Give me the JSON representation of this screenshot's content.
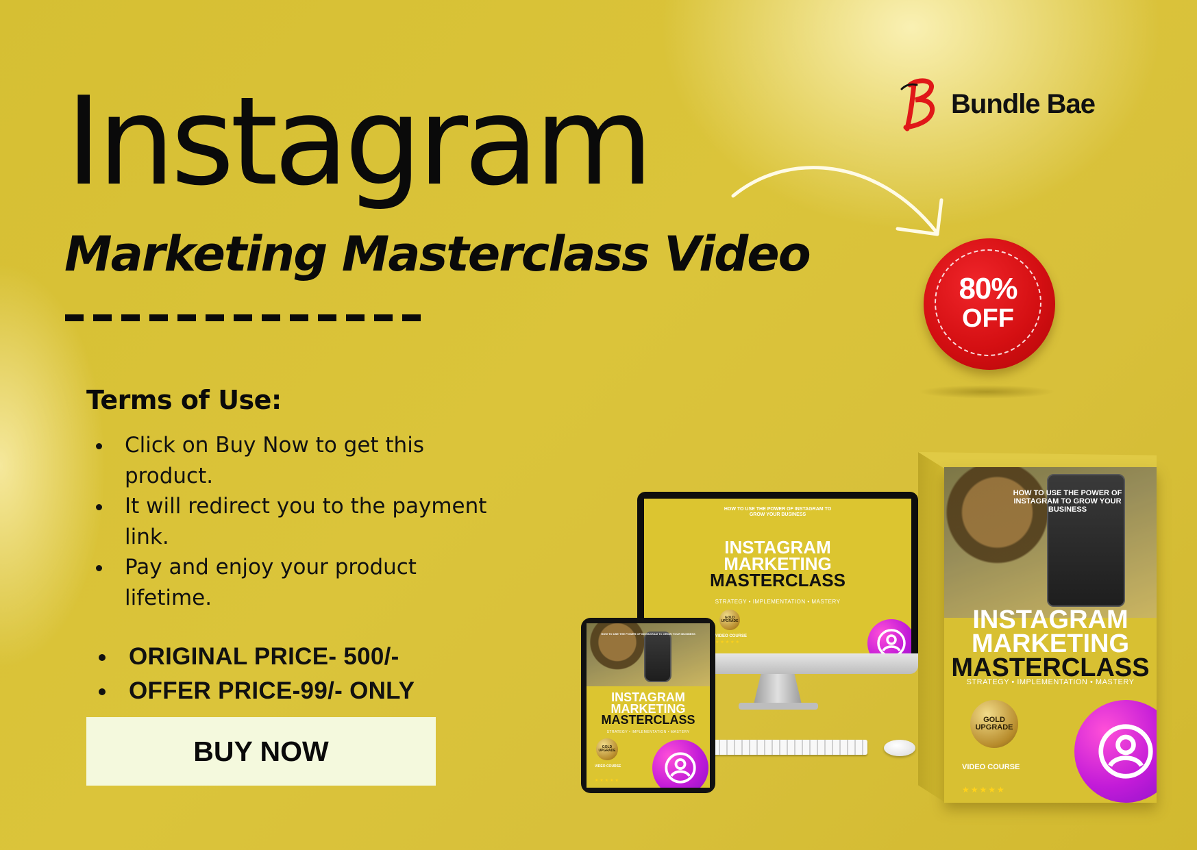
{
  "header": {
    "title": "Instagram",
    "subtitle": "Marketing Masterclass Video"
  },
  "brand": {
    "name": "Bundle Bae",
    "logo_letter": "B",
    "logo_color": "#e01818"
  },
  "badge": {
    "percent": "80%",
    "off": "OFF",
    "color": "#d40f12"
  },
  "terms": {
    "title": "Terms of Use:",
    "items": [
      "Click on Buy Now to get this product.",
      "It will redirect you to the payment link.",
      "Pay and enjoy your product lifetime."
    ]
  },
  "pricing": {
    "original": "ORIGINAL PRICE- 500/-",
    "offer": "OFFER PRICE-99/- ONLY"
  },
  "cta": {
    "label": "BUY NOW"
  },
  "product": {
    "tagline_top": "HOW TO USE THE POWER OF INSTAGRAM TO GROW YOUR BUSINESS",
    "title_line1": "INSTAGRAM",
    "title_line2": "MARKETING",
    "title_line3": "MASTERCLASS",
    "tagline_bottom": "STRATEGY • IMPLEMENTATION • MASTERY",
    "gold_badge": "GOLD UPGRADE",
    "course_type": "VIDEO COURSE",
    "stars": "★★★★★",
    "icon": "instagram-profile-icon"
  },
  "colors": {
    "background": "#d8c03a",
    "cta_background": "#f4f9dd",
    "accent_purple": "#c21bd8"
  }
}
